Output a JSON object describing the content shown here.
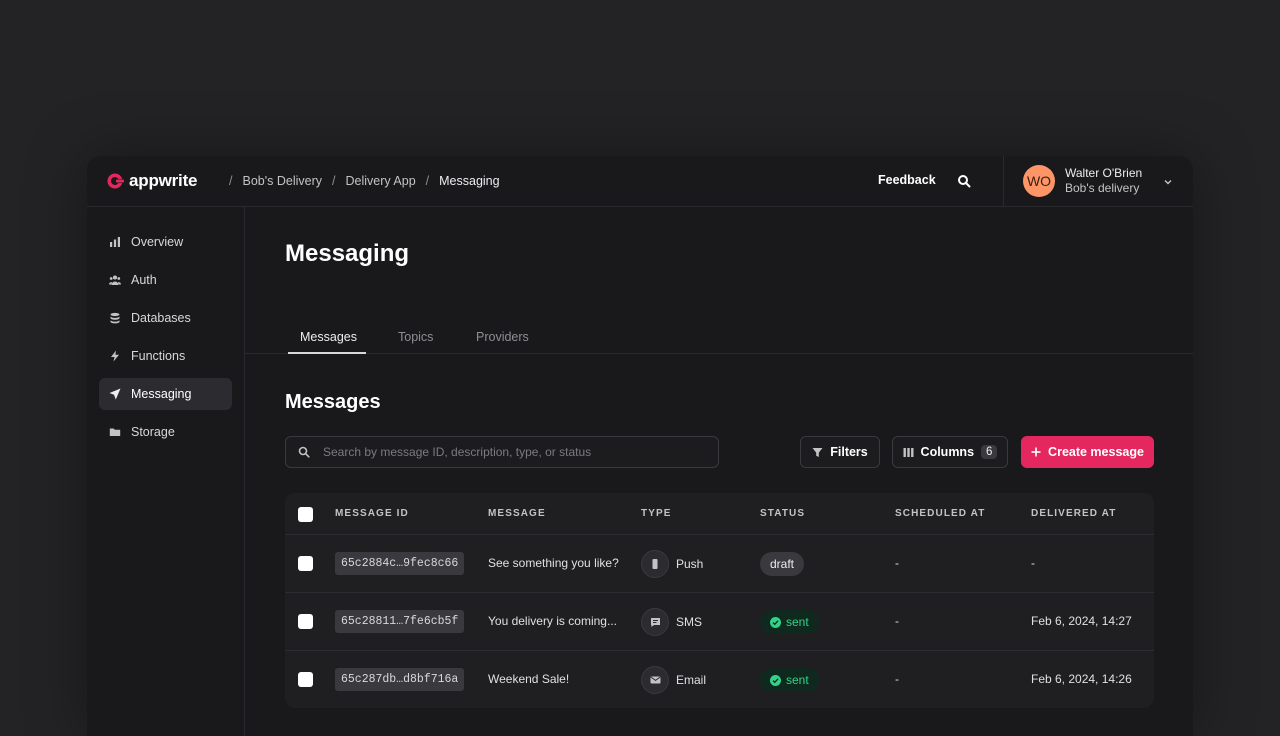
{
  "brand": {
    "name": "appwrite",
    "accent": "#e4285f"
  },
  "breadcrumb": {
    "org": "Bob's Delivery",
    "project": "Delivery App",
    "current": "Messaging"
  },
  "header": {
    "feedback": "Feedback"
  },
  "user": {
    "initials": "WO",
    "name": "Walter O'Brien",
    "org": "Bob's delivery"
  },
  "sidebar": {
    "items": [
      {
        "label": "Overview",
        "icon": "bar-chart-icon"
      },
      {
        "label": "Auth",
        "icon": "users-icon"
      },
      {
        "label": "Databases",
        "icon": "database-icon"
      },
      {
        "label": "Functions",
        "icon": "lightning-icon"
      },
      {
        "label": "Messaging",
        "icon": "send-icon",
        "active": true
      },
      {
        "label": "Storage",
        "icon": "folder-icon"
      }
    ]
  },
  "page": {
    "title": "Messaging"
  },
  "tabs": [
    {
      "label": "Messages",
      "active": true
    },
    {
      "label": "Topics"
    },
    {
      "label": "Providers"
    }
  ],
  "section": {
    "title": "Messages"
  },
  "search": {
    "placeholder": "Search by message ID, description, type, or status"
  },
  "toolbar": {
    "filters": "Filters",
    "columns": "Columns",
    "columns_count": "6",
    "create": "Create message"
  },
  "table": {
    "headers": [
      "MESSAGE ID",
      "MESSAGE",
      "TYPE",
      "STATUS",
      "SCHEDULED AT",
      "DELIVERED AT"
    ],
    "rows": [
      {
        "id": "65c2884c…9fec8c66",
        "message": "See something you like?",
        "type": "Push",
        "type_icon": "phone-icon",
        "status": "draft",
        "scheduled": "-",
        "delivered": "-"
      },
      {
        "id": "65c28811…7fe6cb5f",
        "message": "You delivery is coming...",
        "type": "SMS",
        "type_icon": "chat-icon",
        "status": "sent",
        "scheduled": "-",
        "delivered": "Feb 6, 2024, 14:27"
      },
      {
        "id": "65c287db…d8bf716a",
        "message": "Weekend Sale!",
        "type": "Email",
        "type_icon": "mail-icon",
        "status": "sent",
        "scheduled": "-",
        "delivered": "Feb 6, 2024, 14:26"
      }
    ]
  }
}
